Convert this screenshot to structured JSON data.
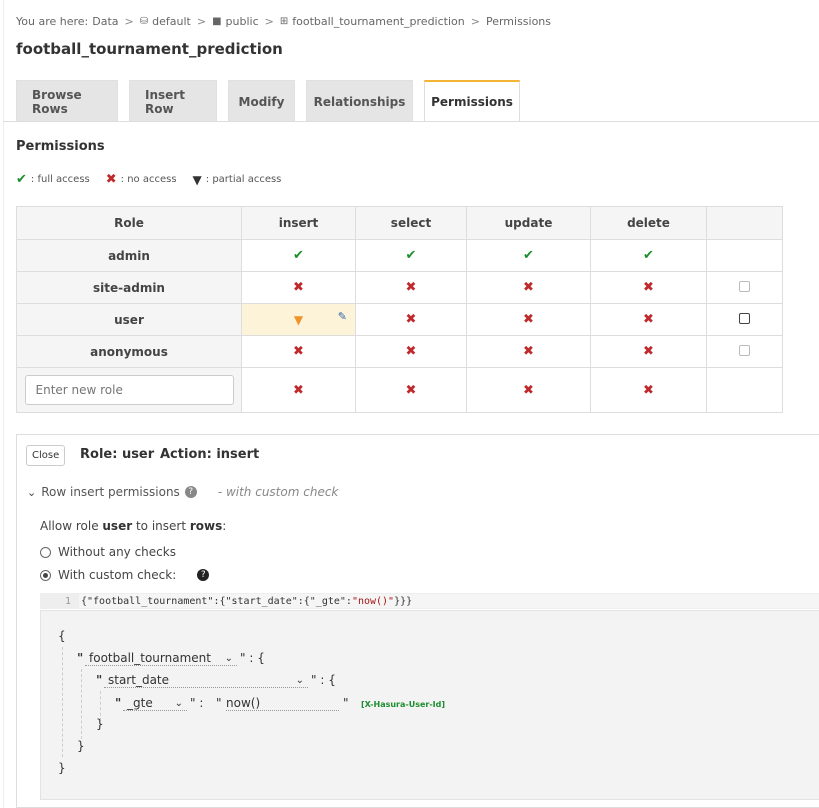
{
  "breadcrumb": {
    "prefix": "You are here:",
    "items": [
      "Data",
      "default",
      "public",
      "football_tournament_prediction",
      "Permissions"
    ]
  },
  "page_title": "football_tournament_prediction",
  "tabs": [
    "Browse Rows",
    "Insert Row",
    "Modify",
    "Relationships",
    "Permissions"
  ],
  "active_tab": "Permissions",
  "permissions": {
    "title": "Permissions",
    "legend": {
      "full": ": full access",
      "none": ": no access",
      "partial": ": partial access"
    },
    "columns": [
      "Role",
      "insert",
      "select",
      "update",
      "delete",
      ""
    ],
    "rows": [
      {
        "role": "admin",
        "insert": "full",
        "select": "full",
        "update": "full",
        "delete": "full",
        "checkbox": "none"
      },
      {
        "role": "site-admin",
        "insert": "none",
        "select": "none",
        "update": "none",
        "delete": "none",
        "checkbox": "disabled"
      },
      {
        "role": "user",
        "insert": "partial",
        "select": "none",
        "update": "none",
        "delete": "none",
        "checkbox": "enabled"
      },
      {
        "role": "anonymous",
        "insert": "none",
        "select": "none",
        "update": "none",
        "delete": "none",
        "checkbox": "disabled"
      }
    ],
    "new_role_placeholder": "Enter new role"
  },
  "panel": {
    "close_label": "Close",
    "role_text": "Role: user",
    "action_text": "Action: insert",
    "section_label": "Row insert permissions",
    "section_hint": "- with custom check",
    "allow_prefix": "Allow role ",
    "allow_role": "user",
    "allow_mid": " to insert ",
    "allow_target": "rows",
    "allow_suffix": ":",
    "option_none": "Without any checks",
    "option_custom": "With custom check:",
    "selected_option": "custom"
  },
  "code": {
    "line_number": "1",
    "prefix": "{\"football_tournament\":{\"start_date\":{\"_gte\":",
    "string": "\"now()\"",
    "suffix": "}}}"
  },
  "builder": {
    "open_brace": "{",
    "close_brace": "}",
    "quote": "\"",
    "colon_open": "\" :   {",
    "colon_plain": "\" :",
    "field1": "football_tournament",
    "field2": "start_date",
    "operator": "_gte",
    "value": "now()",
    "value_hint": "[X-Hasura-User-Id]"
  }
}
